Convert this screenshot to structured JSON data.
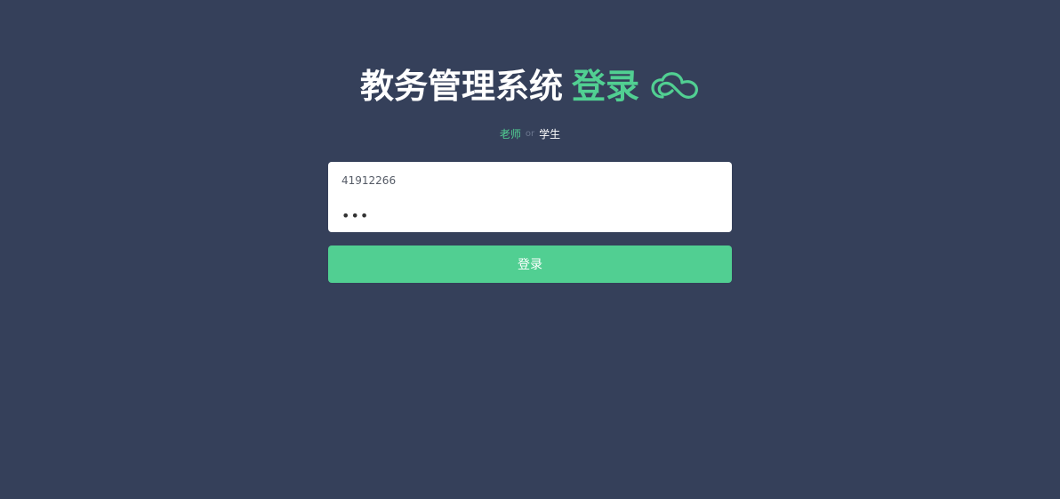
{
  "header": {
    "title": "教务管理系统",
    "title_accent": "登录",
    "icon": "cloud-icon"
  },
  "roles": {
    "teacher": "老师",
    "separator": "or",
    "student": "学生"
  },
  "form": {
    "username_value": "41912266",
    "password_value": "•••"
  },
  "login_button": {
    "label": "登录"
  },
  "colors": {
    "background": "#35405a",
    "accent": "#51cf92",
    "text_light": "#ffffff"
  }
}
